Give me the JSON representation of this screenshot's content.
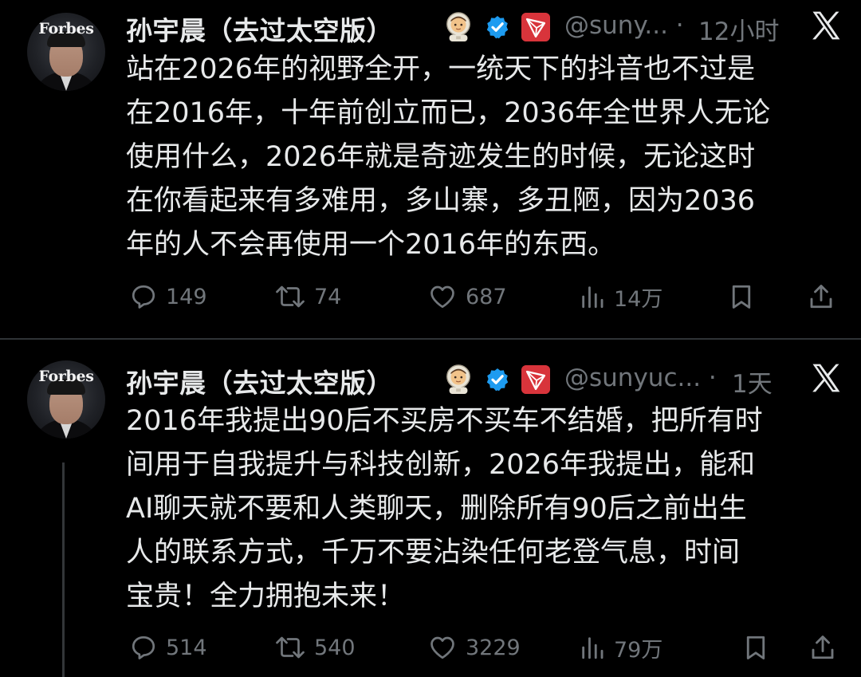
{
  "colors": {
    "background": "#000000",
    "text": "#e7e9ea",
    "muted": "#71767b",
    "verified_blue": "#1d9bf0",
    "tron_red": "#d8343b",
    "divider": "#2f3336"
  },
  "tweets": [
    {
      "author": {
        "name": "孙宇晨（去过太空版）",
        "avatar_text": "Forbes",
        "name_emoji": "astronaut-icon",
        "badges": [
          "verified-badge-icon",
          "tron-logo-icon"
        ],
        "handle": "@suny...",
        "separator": "·",
        "time": "12小时"
      },
      "platform_icon": "x-logo-icon",
      "text_lines": [
        "站在2026年的视野全开，一统天下的抖音也不过是",
        "在2016年，十年前创立而已，2036年全世界人无论",
        "使用什么，2026年就是奇迹发生的时候，无论这时",
        "在你看起来有多难用，多山寨，多丑陋，因为2036",
        "年的人不会再使用一个2016年的东西。"
      ],
      "actions": {
        "replies": "149",
        "reposts": "74",
        "likes": "687",
        "views": "14万"
      }
    },
    {
      "author": {
        "name": "孙宇晨（去过太空版）",
        "avatar_text": "Forbes",
        "name_emoji": "astronaut-icon",
        "badges": [
          "verified-badge-icon",
          "tron-logo-icon"
        ],
        "handle": "@sunyuc...",
        "separator": "·",
        "time": "1天"
      },
      "platform_icon": "x-logo-icon",
      "text_lines": [
        "2016年我提出90后不买房不买车不结婚，把所有时",
        "间用于自我提升与科技创新，2026年我提出，能和",
        "AI聊天就不要和人类聊天，删除所有90后之前出生",
        "人的联系方式，千万不要沾染任何老登气息，时间",
        "宝贵！全力拥抱未来！"
      ],
      "actions": {
        "replies": "514",
        "reposts": "540",
        "likes": "3229",
        "views": "79万"
      }
    }
  ]
}
